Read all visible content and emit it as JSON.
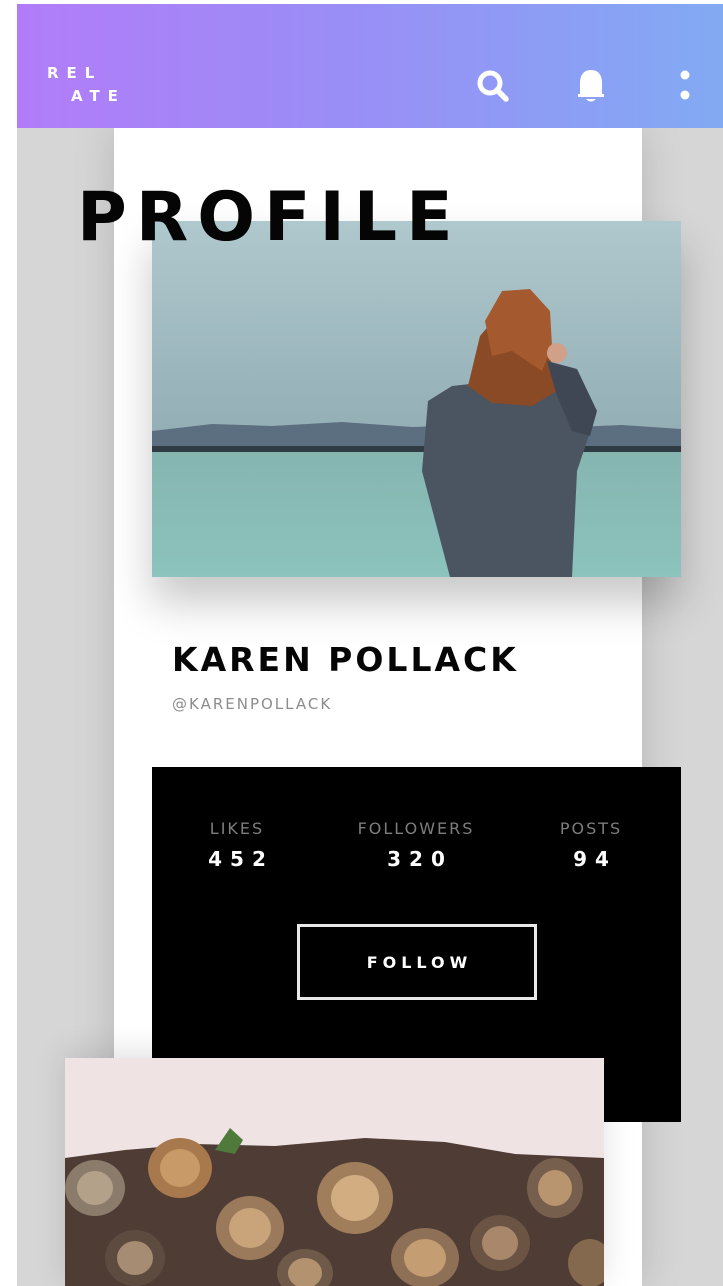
{
  "app": {
    "logo_line1": "REL",
    "logo_line2": "ATE"
  },
  "header": {
    "icons": [
      "search-icon",
      "bell-icon",
      "more-vertical-icon"
    ],
    "gradient_start": "#b27cf9",
    "gradient_end": "#82aaf3"
  },
  "page": {
    "title": "PROFILE"
  },
  "profile": {
    "name": "KAREN POLLACK",
    "handle": "@KARENPOLLACK"
  },
  "stats": [
    {
      "label": "LIKES",
      "value": "452"
    },
    {
      "label": "FOLLOWERS",
      "value": "320"
    },
    {
      "label": "POSTS",
      "value": "94"
    }
  ],
  "actions": {
    "follow_label": "FOLLOW"
  },
  "colors": {
    "frame_background": "#d6d6d6",
    "card_background": "#ffffff",
    "stats_background": "#000000",
    "text_primary": "#050505",
    "text_muted": "#8c8c8c"
  }
}
